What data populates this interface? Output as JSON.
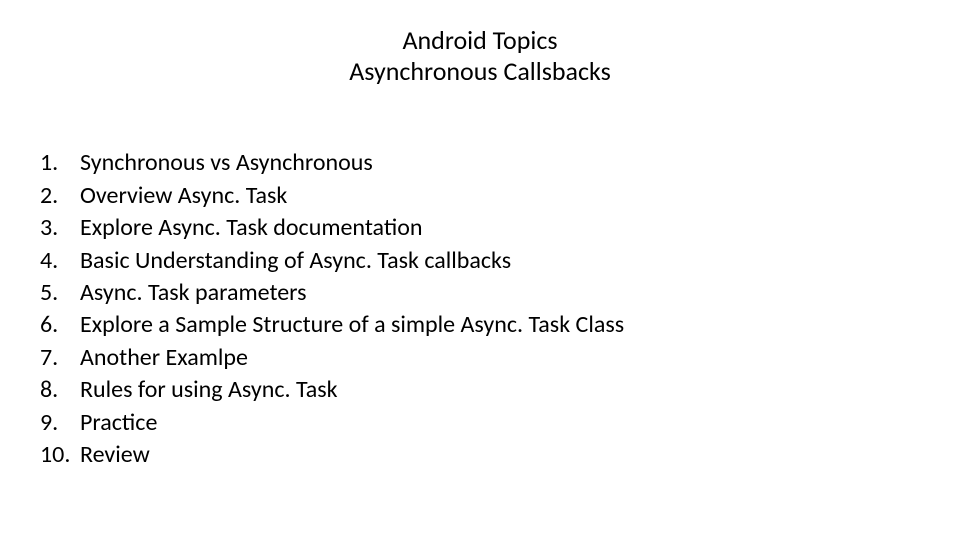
{
  "header": {
    "line1": "Android Topics",
    "line2": "Asynchronous Callsbacks"
  },
  "list": {
    "items": [
      {
        "num": "1.",
        "text": "Synchronous vs Asynchronous"
      },
      {
        "num": "2.",
        "text": "Overview Async. Task"
      },
      {
        "num": "3.",
        "text": "Explore Async. Task documentation"
      },
      {
        "num": "4.",
        "text": "Basic Understanding of Async. Task callbacks"
      },
      {
        "num": "5.",
        "text": "Async. Task parameters"
      },
      {
        "num": "6.",
        "text": "Explore a Sample Structure of a simple Async. Task Class"
      },
      {
        "num": "7.",
        "text": "Another Examlpe"
      },
      {
        "num": "8.",
        "text": "Rules for using Async. Task"
      },
      {
        "num": "9.",
        "text": "Practice"
      },
      {
        "num": "10.",
        "text": "Review"
      }
    ]
  }
}
